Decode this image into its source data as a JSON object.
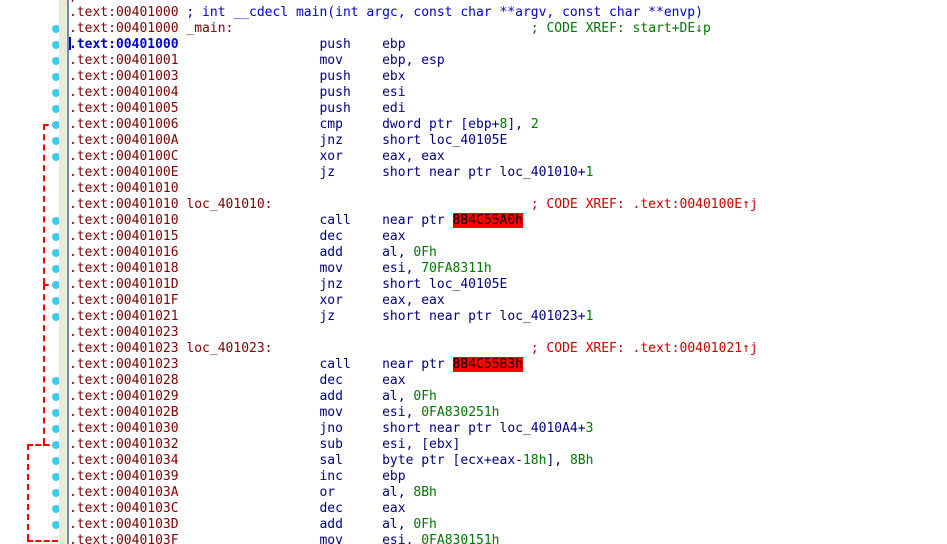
{
  "app": {
    "name": "IDA Pro Disassembly View",
    "segment_prefix": ".text:",
    "colors": {
      "background": "#ffffff",
      "address": "#800000",
      "current_address": "#0000cc",
      "mnemonic": "#000080",
      "operand": "#000080",
      "number": "#007700",
      "xref_green": "#007700",
      "xref_red": "#cc0000",
      "highlight_bg": "#ff0000",
      "highlight_fg": "#000000",
      "arrow": "#ff0000",
      "marker_dot": "#45c8f0",
      "strip": "#ece9d8",
      "strip_border": "#6f8faf"
    }
  },
  "gutter": {
    "dot_icon": "breakpoint-dot-icon",
    "arrow_icon": "jump-arrow-icon",
    "dot_rows": [
      2,
      3,
      4,
      5,
      6,
      7,
      8,
      9,
      10,
      14,
      15,
      16,
      17,
      18,
      19,
      20,
      24,
      25,
      26,
      27,
      28,
      29,
      30,
      31,
      32,
      33
    ],
    "arrows": [
      {
        "name": "jump-arrow-401010",
        "from_row": 8,
        "to_row": 18,
        "column": 1,
        "head_row": 8
      },
      {
        "name": "jump-arrow-401023",
        "from_row": 18,
        "to_row": 28,
        "column": 1,
        "head_row": 18
      },
      {
        "name": "jump-arrow-4010a4",
        "from_row": 28,
        "to_row": 34,
        "column": 2,
        "head_row": 28
      }
    ]
  },
  "listing": {
    "line_height": 16,
    "lines": [
      {
        "address": "00401000",
        "label": "",
        "mnemonic": "",
        "operands": "",
        "comment": "",
        "separator": true,
        "current": false,
        "text_kind": "separator"
      },
      {
        "address": "00401000",
        "label": "",
        "mnemonic": "",
        "operands": "",
        "comment": "",
        "decl": "; int __cdecl main(int argc, const char **argv, const char **envp)",
        "current": false,
        "text_kind": "decl"
      },
      {
        "address": "00401000",
        "label": "_main:",
        "mnemonic": "",
        "operands": "",
        "comment": "; CODE XREF: start+DE↓p",
        "comment_color": "green",
        "current": false,
        "text_kind": "label"
      },
      {
        "address": "00401000",
        "label": "",
        "mnemonic": "push",
        "operands": "ebp",
        "comment": "",
        "current": true,
        "text_kind": "insn"
      },
      {
        "address": "00401001",
        "label": "",
        "mnemonic": "mov",
        "operands": "ebp, esp",
        "comment": "",
        "current": false,
        "text_kind": "insn"
      },
      {
        "address": "00401003",
        "label": "",
        "mnemonic": "push",
        "operands": "ebx",
        "comment": "",
        "current": false,
        "text_kind": "insn"
      },
      {
        "address": "00401004",
        "label": "",
        "mnemonic": "push",
        "operands": "esi",
        "comment": "",
        "current": false,
        "text_kind": "insn"
      },
      {
        "address": "00401005",
        "label": "",
        "mnemonic": "push",
        "operands": "edi",
        "comment": "",
        "current": false,
        "text_kind": "insn"
      },
      {
        "address": "00401006",
        "label": "",
        "mnemonic": "cmp",
        "operands": "dword ptr [ebp+8], 2",
        "comment": "",
        "current": false,
        "text_kind": "insn"
      },
      {
        "address": "0040100A",
        "label": "",
        "mnemonic": "jnz",
        "operands": "short loc_40105E",
        "comment": "",
        "current": false,
        "text_kind": "insn"
      },
      {
        "address": "0040100C",
        "label": "",
        "mnemonic": "xor",
        "operands": "eax, eax",
        "comment": "",
        "current": false,
        "text_kind": "insn"
      },
      {
        "address": "0040100E",
        "label": "",
        "mnemonic": "jz",
        "operands": "short near ptr loc_401010+1",
        "comment": "",
        "current": false,
        "text_kind": "insn"
      },
      {
        "address": "00401010",
        "label": "",
        "mnemonic": "",
        "operands": "",
        "comment": "",
        "current": false,
        "text_kind": "blank"
      },
      {
        "address": "00401010",
        "label": "loc_401010:",
        "mnemonic": "",
        "operands": "",
        "comment": "; CODE XREF: .text:0040100E↑j",
        "comment_color": "red",
        "current": false,
        "text_kind": "label"
      },
      {
        "address": "00401010",
        "label": "",
        "mnemonic": "call",
        "operands": "near ptr ",
        "highlight": "8B4C55A0h",
        "comment": "",
        "current": false,
        "text_kind": "insn"
      },
      {
        "address": "00401015",
        "label": "",
        "mnemonic": "dec",
        "operands": "eax",
        "comment": "",
        "current": false,
        "text_kind": "insn"
      },
      {
        "address": "00401016",
        "label": "",
        "mnemonic": "add",
        "operands": "al, 0Fh",
        "comment": "",
        "current": false,
        "text_kind": "insn"
      },
      {
        "address": "00401018",
        "label": "",
        "mnemonic": "mov",
        "operands": "esi, 70FA8311h",
        "comment": "",
        "current": false,
        "text_kind": "insn"
      },
      {
        "address": "0040101D",
        "label": "",
        "mnemonic": "jnz",
        "operands": "short loc_40105E",
        "comment": "",
        "current": false,
        "text_kind": "insn"
      },
      {
        "address": "0040101F",
        "label": "",
        "mnemonic": "xor",
        "operands": "eax, eax",
        "comment": "",
        "current": false,
        "text_kind": "insn"
      },
      {
        "address": "00401021",
        "label": "",
        "mnemonic": "jz",
        "operands": "short near ptr loc_401023+1",
        "comment": "",
        "current": false,
        "text_kind": "insn"
      },
      {
        "address": "00401023",
        "label": "",
        "mnemonic": "",
        "operands": "",
        "comment": "",
        "current": false,
        "text_kind": "blank"
      },
      {
        "address": "00401023",
        "label": "loc_401023:",
        "mnemonic": "",
        "operands": "",
        "comment": "; CODE XREF: .text:00401021↑j",
        "comment_color": "red",
        "current": false,
        "text_kind": "label"
      },
      {
        "address": "00401023",
        "label": "",
        "mnemonic": "call",
        "operands": "near ptr ",
        "highlight": "8B4C55B3h",
        "comment": "",
        "current": false,
        "text_kind": "insn"
      },
      {
        "address": "00401028",
        "label": "",
        "mnemonic": "dec",
        "operands": "eax",
        "comment": "",
        "current": false,
        "text_kind": "insn"
      },
      {
        "address": "00401029",
        "label": "",
        "mnemonic": "add",
        "operands": "al, 0Fh",
        "comment": "",
        "current": false,
        "text_kind": "insn"
      },
      {
        "address": "0040102B",
        "label": "",
        "mnemonic": "mov",
        "operands": "esi, 0FA830251h",
        "comment": "",
        "current": false,
        "text_kind": "insn"
      },
      {
        "address": "00401030",
        "label": "",
        "mnemonic": "jno",
        "operands": "short near ptr loc_4010A4+3",
        "comment": "",
        "current": false,
        "text_kind": "insn"
      },
      {
        "address": "00401032",
        "label": "",
        "mnemonic": "sub",
        "operands": "esi, [ebx]",
        "comment": "",
        "current": false,
        "text_kind": "insn"
      },
      {
        "address": "00401034",
        "label": "",
        "mnemonic": "sal",
        "operands": "byte ptr [ecx+eax-18h], 8Bh",
        "comment": "",
        "current": false,
        "text_kind": "insn"
      },
      {
        "address": "00401039",
        "label": "",
        "mnemonic": "inc",
        "operands": "ebp",
        "comment": "",
        "current": false,
        "text_kind": "insn"
      },
      {
        "address": "0040103A",
        "label": "",
        "mnemonic": "or",
        "operands": "al, 8Bh",
        "comment": "",
        "current": false,
        "text_kind": "insn"
      },
      {
        "address": "0040103C",
        "label": "",
        "mnemonic": "dec",
        "operands": "eax",
        "comment": "",
        "current": false,
        "text_kind": "insn"
      },
      {
        "address": "0040103D",
        "label": "",
        "mnemonic": "add",
        "operands": "al, 0Fh",
        "comment": "",
        "current": false,
        "text_kind": "insn"
      },
      {
        "address": "0040103F",
        "label": "",
        "mnemonic": "mov",
        "operands": "esi, 0FA830151h",
        "comment": "",
        "current": false,
        "text_kind": "insn"
      }
    ]
  }
}
